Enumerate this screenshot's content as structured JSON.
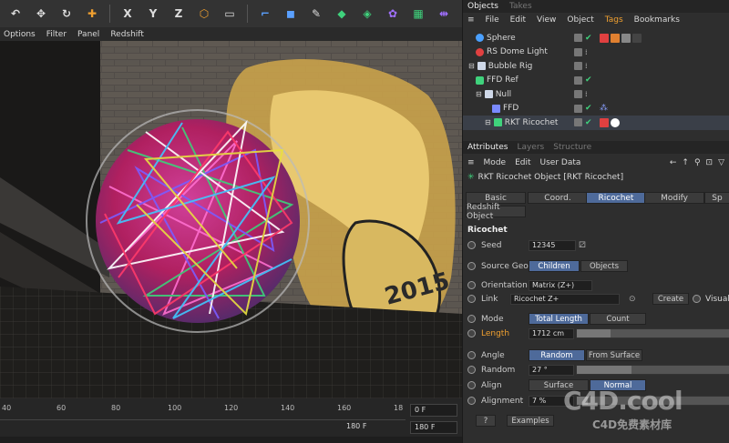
{
  "toolbar": {
    "icons": [
      "undo-icon",
      "move-icon",
      "rotate-icon",
      "plus-icon",
      "x-axis-icon",
      "y-axis-icon",
      "z-axis-icon",
      "world-icon",
      "render-view-icon",
      "select-icon",
      "cube-icon",
      "pen-icon",
      "green-cube-icon",
      "deform-icon",
      "scene-icon",
      "effector-icon",
      "mograph-icon"
    ],
    "axis_x": "X",
    "axis_y": "Y",
    "axis_z": "Z"
  },
  "view_menu": [
    "Options",
    "Filter",
    "Panel",
    "Redshift"
  ],
  "viewport": {
    "graffiti_text": "2015"
  },
  "timeline": {
    "ticks": [
      "40",
      "60",
      "80",
      "100",
      "120",
      "140",
      "160",
      "18"
    ],
    "frame_current": "0 F",
    "frame_end_a": "180 F",
    "frame_end_b": "180 F"
  },
  "objects_panel": {
    "tabs": [
      "Objects",
      "Takes"
    ],
    "menu": [
      "File",
      "Edit",
      "View",
      "Object",
      "Tags",
      "Bookmarks"
    ],
    "items": [
      {
        "name": "Sphere",
        "color": "#4aa0ff"
      },
      {
        "name": "RS Dome Light",
        "color": "#e04040"
      },
      {
        "name": "Bubble Rig",
        "color": "#cfd8e8"
      },
      {
        "name": "FFD Ref",
        "color": "#3fd27c"
      },
      {
        "name": "Null",
        "color": "#cfd8e8"
      },
      {
        "name": "FFD",
        "color": "#7a8aff"
      },
      {
        "name": "RKT Ricochet",
        "color": "#3fd27c"
      }
    ]
  },
  "attributes": {
    "tabs": [
      "Attributes",
      "Layers",
      "Structure"
    ],
    "menu": [
      "Mode",
      "Edit",
      "User Data"
    ],
    "object_title": "RKT Ricochet Object [RKT Ricochet]",
    "prop_tabs": [
      "Basic",
      "Coord.",
      "Ricochet",
      "Modify",
      "Sp"
    ],
    "prop_tab_2": "Redshift Object",
    "section": "Ricochet",
    "seed_label": "Seed",
    "seed_value": "12345",
    "source_geo_label": "Source Geo",
    "source_geo_opt1": "Children",
    "source_geo_opt2": "Objects",
    "orientation_label": "Orientation",
    "orientation_value": "Matrix (Z+)",
    "link_label": "Link",
    "link_value": "Ricochet Z+",
    "create_label": "Create",
    "visual_label": "Visual",
    "mode_label": "Mode",
    "mode_opt1": "Total Length",
    "mode_opt2": "Count",
    "length_label": "Length",
    "length_value": "1712 cm",
    "angle_label": "Angle",
    "angle_opt1": "Random",
    "angle_opt2": "From Surface",
    "random_label": "Random",
    "random_value": "27 °",
    "align_label": "Align",
    "align_opt1": "Surface",
    "align_opt2": "Normal",
    "alignment_label": "Alignment",
    "alignment_value": "7 %",
    "help_label": "?",
    "examples_label": "Examples"
  },
  "watermark": {
    "logo": "C4D.cool",
    "sub": "C4D免费素材库"
  }
}
